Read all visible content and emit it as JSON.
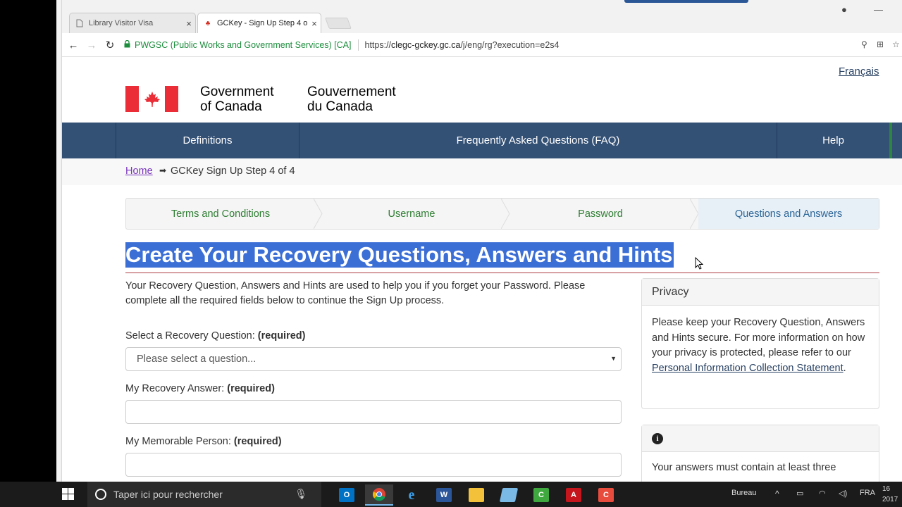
{
  "colors": {
    "gc_blue": "#335075",
    "gc_red": "#eb2d37",
    "link": "#284162",
    "step_green": "#2e7d32",
    "selection": "#3b6fd6"
  },
  "browser": {
    "tabs": [
      {
        "label": "Library Visitor Visa",
        "icon": "page-icon",
        "close": "×"
      },
      {
        "label": "GCKey - Sign Up Step 4 o",
        "icon": "maple-leaf-icon",
        "close": "×"
      }
    ],
    "omnibox": {
      "lock_icon": "lock-icon",
      "ev_label": "PWGSC (Public Works and Government Services) [CA]",
      "url_prefix": "https://",
      "url_domain": "clegc-gckey.gc.ca",
      "url_path": "/j/eng/rg?execution=e2s4"
    },
    "nav": {
      "back": "←",
      "forward": "→",
      "reload": "↻"
    }
  },
  "header": {
    "language_toggle": "Français",
    "signature_en_1": "Government",
    "signature_en_2": "of Canada",
    "signature_fr_1": "Gouvernement",
    "signature_fr_2": "du Canada"
  },
  "menu": {
    "items": [
      {
        "label": "Definitions"
      },
      {
        "label": "Frequently Asked Questions (FAQ)"
      },
      {
        "label": "Help"
      }
    ]
  },
  "breadcrumb": {
    "home": "Home",
    "arrow": "➡",
    "current": "GCKey Sign Up Step 4 of 4"
  },
  "steps": [
    {
      "label": "Terms and Conditions"
    },
    {
      "label": "Username"
    },
    {
      "label": "Password"
    },
    {
      "label": "Questions and Answers"
    }
  ],
  "main": {
    "heading": "Create Your Recovery Questions, Answers and Hints",
    "intro": "Your Recovery Question, Answers and Hints are used to help you if you forget your Password. Please complete all the required fields below to continue the Sign Up process.",
    "required": "(required)",
    "fields": [
      {
        "label": "Select a Recovery Question:",
        "value": "Please select a question..."
      },
      {
        "label": "My Recovery Answer:",
        "value": ""
      },
      {
        "label": "My Memorable Person:",
        "value": ""
      }
    ]
  },
  "privacy": {
    "title": "Privacy",
    "body": "Please keep your Recovery Question, Answers and Hints secure. For more information on how your privacy is protected, please refer to our ",
    "link": "Personal Information Collection Statement",
    "tail": "."
  },
  "info": {
    "icon": "info-icon",
    "body": "Your answers must contain at least three"
  },
  "taskbar": {
    "search_placeholder": "Taper ici pour rechercher",
    "tray_label": "Bureau",
    "language": "FRA",
    "clock_top": "16",
    "clock_bottom": "2017"
  }
}
